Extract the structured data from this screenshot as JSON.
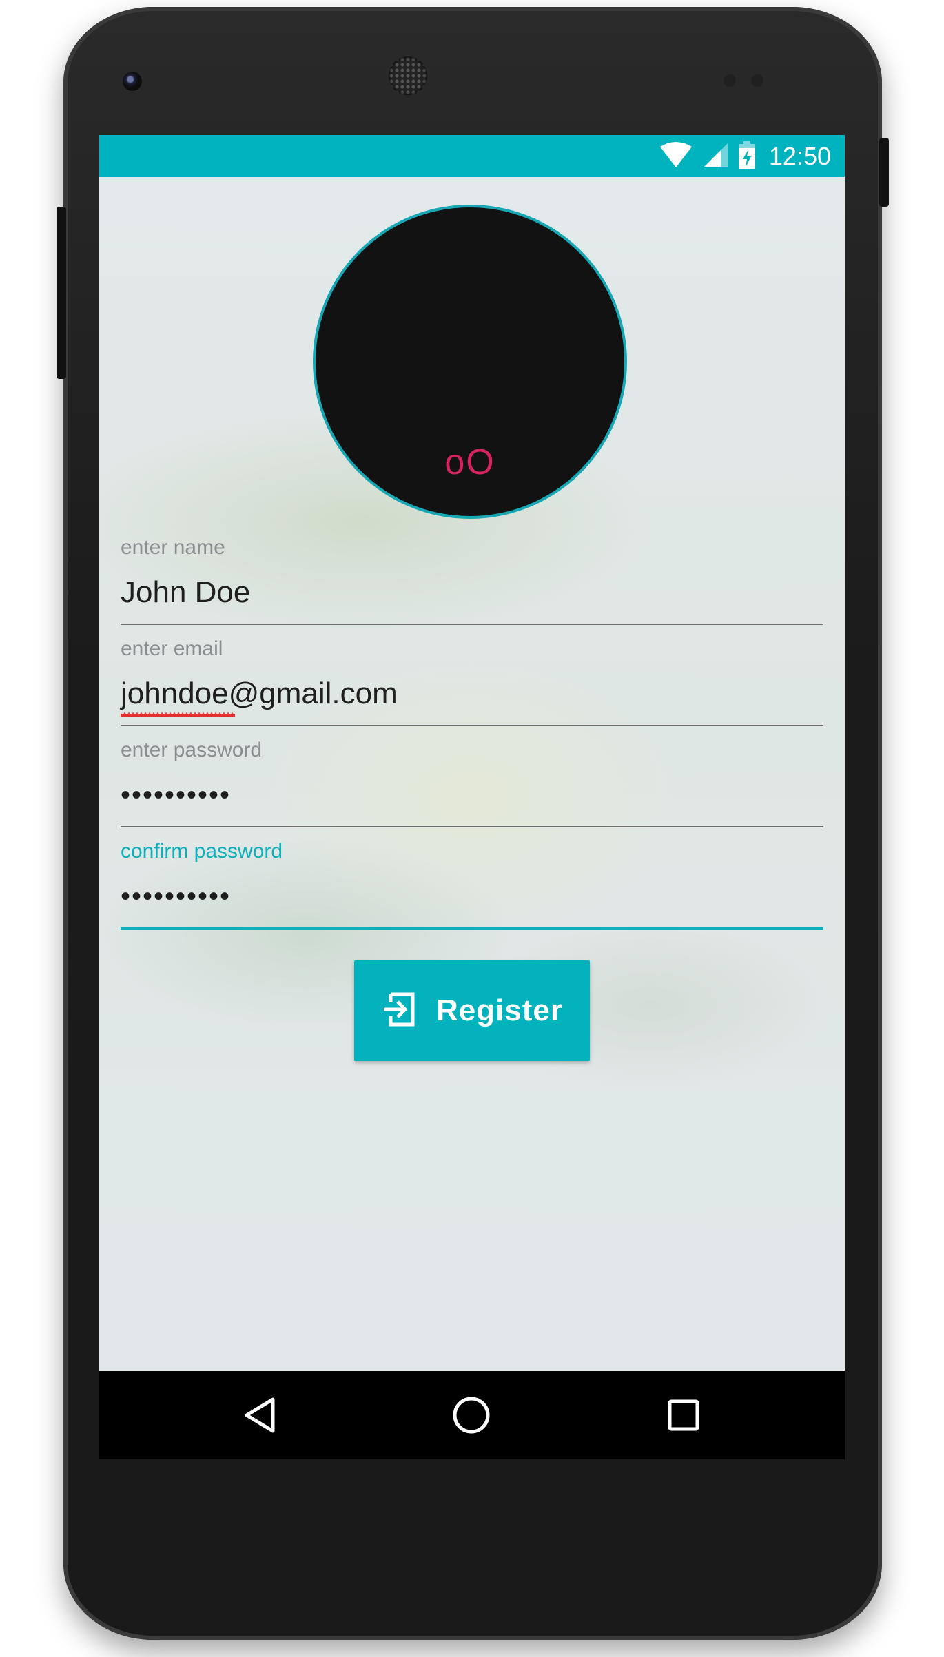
{
  "status_bar": {
    "time": "12:50",
    "icons": [
      "wifi-icon",
      "cell-signal-icon",
      "battery-charging-icon"
    ],
    "color": "#00b3be"
  },
  "avatar": {
    "text": "oO",
    "text_color": "#d4245e",
    "border_color": "#17a7b4"
  },
  "form": {
    "name": {
      "label": "enter name",
      "value": "John Doe"
    },
    "email": {
      "label": "enter email",
      "value": "johndoe@gmail.com"
    },
    "password": {
      "label": "enter password",
      "value": "••••••••••"
    },
    "confirm_password": {
      "label": "confirm password",
      "value": "••••••••••"
    }
  },
  "register_button": {
    "label": "Register",
    "icon": "login-icon",
    "color": "#03b2bd"
  },
  "nav_bar": {
    "buttons": [
      "back-icon",
      "home-icon",
      "recents-icon"
    ]
  }
}
